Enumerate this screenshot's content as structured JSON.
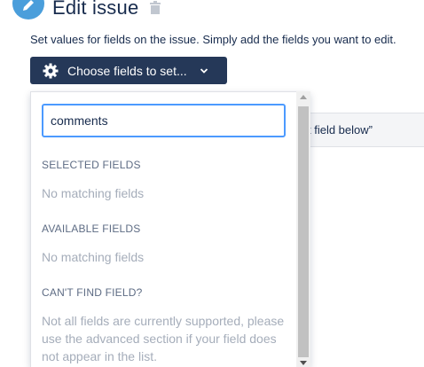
{
  "header": {
    "title": "Edit issue",
    "edit_icon": "pencil-icon",
    "delete_icon": "trash-icon",
    "badge_color": "#4a9edb"
  },
  "description": "Set values for fields on the issue. Simply add the fields you want to edit.",
  "choose_button": {
    "label": "Choose fields to set...",
    "icon": "gear-icon",
    "dropdown_icon": "chevron-down-icon",
    "background": "#253858"
  },
  "background_field": {
    "text": "t field below”"
  },
  "dropdown": {
    "search": {
      "value": "comments",
      "placeholder": ""
    },
    "sections": [
      {
        "heading": "SELECTED FIELDS",
        "empty_text": "No matching fields"
      },
      {
        "heading": "AVAILABLE FIELDS",
        "empty_text": "No matching fields"
      },
      {
        "heading": "CAN'T FIND FIELD?",
        "empty_text": ""
      }
    ],
    "help_text": "Not all fields are currently supported, please use the advanced section if your field does not appear in the list."
  }
}
